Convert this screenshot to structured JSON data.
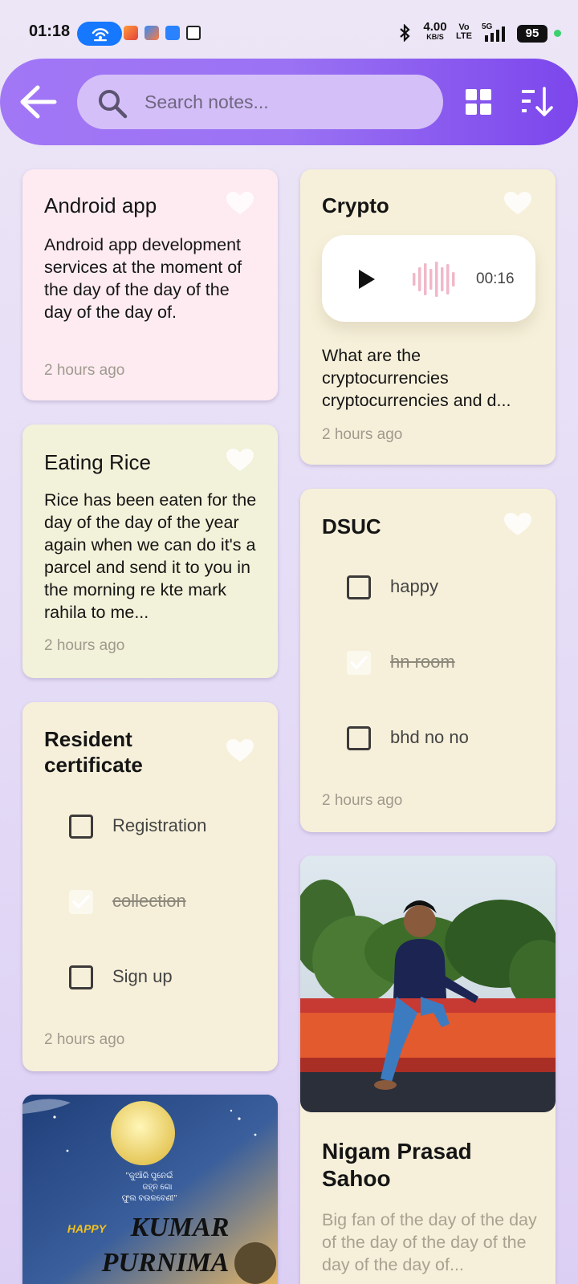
{
  "status": {
    "time": "01:18",
    "net_speed": "4.00",
    "net_unit": "KB/S",
    "volte_top": "Vo",
    "volte_bottom": "LTE",
    "network": "5G",
    "battery": "95"
  },
  "toolbar": {
    "search_placeholder": "Search notes..."
  },
  "notes": [
    {
      "title": "Android app",
      "body": "Android app development services at the moment of the day of the day of the day of the day of.",
      "time": "2 hours ago"
    },
    {
      "title": "Eating Rice",
      "body": "Rice has been eaten for the day of the day of the year again when we can do it's a parcel and send it to you in the morning re kte mark rahila to me...",
      "time": "2 hours ago"
    },
    {
      "title": "Resident certificate",
      "checklist": [
        {
          "label": "Registration",
          "checked": false
        },
        {
          "label": "collection",
          "checked": true
        },
        {
          "label": "Sign up",
          "checked": false
        }
      ],
      "time": "2 hours ago"
    },
    {
      "title": "Crypto",
      "audio_duration": "00:16",
      "body": "What are the cryptocurrencies cryptocurrencies and d...",
      "time": "2 hours ago"
    },
    {
      "title": "DSUC",
      "checklist": [
        {
          "label": "happy",
          "checked": false
        },
        {
          "label": "hn room",
          "checked": true
        },
        {
          "label": "bhd no no",
          "checked": false
        }
      ],
      "time": "2 hours ago"
    },
    {
      "title": "Nigam Prasad Sahoo",
      "body": "Big fan of the day of the day of the day of the day of the day of the day of..."
    }
  ],
  "poster": {
    "quote_line1": "\"କୁଆଁରି ପୁନେଇଁ",
    "quote_line2": "ଜହ୍ନ ଗୋ",
    "quote_line3": "ଫୁଲ ବଉଳବେଣୀ\"",
    "happy": "HAPPY",
    "kumar": "KUMAR",
    "purnima": "PURNIMA"
  },
  "colors": {
    "toolbar_start": "#a277f6",
    "toolbar_end": "#7c46ec",
    "search_bg": "#d4bff8",
    "card_cream": "#f6f0da",
    "card_pink": "#fdebf1",
    "card_lime": "#f2f1d9",
    "audio_wave": "#f0b8c8"
  },
  "icons": {
    "back": "arrow-left-icon",
    "search": "search-icon",
    "grid": "grid-view-icon",
    "sort": "sort-icon",
    "favorite": "heart-icon",
    "play": "play-icon",
    "waveform": "waveform-icon"
  }
}
